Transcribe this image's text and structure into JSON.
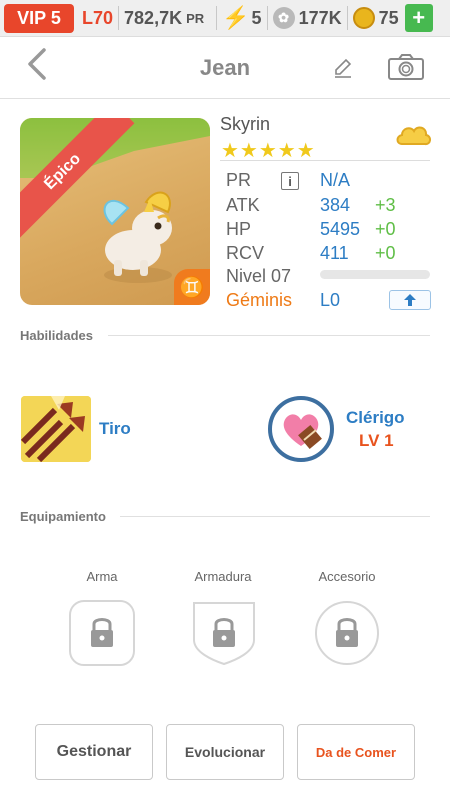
{
  "status": {
    "vip": "VIP 5",
    "level": "L70",
    "pr_value": "782,7K",
    "pr_unit": "PR",
    "energy": "5",
    "paw_count": "177K",
    "coins": "75",
    "plus": "+",
    "colors": {
      "vip": "#e8462b",
      "plus": "#47b950",
      "coin": "#e9b51d"
    }
  },
  "nav": {
    "title": "Jean"
  },
  "hero": {
    "rarity": "Épico",
    "name": "Skyrin",
    "stars": "★★★★★",
    "star_count": 5,
    "stats": {
      "pr_label": "PR",
      "pr_info": "i",
      "pr_value": "N/A",
      "atk_label": "ATK",
      "atk_value": "384",
      "atk_bonus": "+3",
      "hp_label": "HP",
      "hp_value": "5495",
      "hp_bonus": "+0",
      "rcv_label": "RCV",
      "rcv_value": "411",
      "rcv_bonus": "+0"
    },
    "level_label": "Nivel 07",
    "level_progress": 0.0,
    "zodiac_label": "Géminis",
    "zodiac_level": "L0",
    "zodiac_symbol": "♊"
  },
  "skills": {
    "title": "Habilidades",
    "skill_name": "Tiro",
    "class_name": "Clérigo",
    "class_level": "LV 1"
  },
  "equipment": {
    "title": "Equipamiento",
    "slots": [
      "Arma",
      "Armadura",
      "Accesorio"
    ]
  },
  "actions": {
    "manage": "Gestionar",
    "evolve": "Evolucionar",
    "feed": "Da de Comer"
  }
}
